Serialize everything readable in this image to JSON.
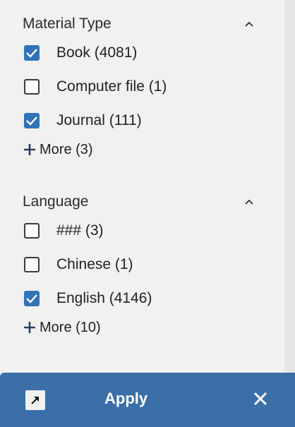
{
  "facets": [
    {
      "title": "Material Type",
      "options": [
        {
          "label": "Book (4081)",
          "checked": true
        },
        {
          "label": "Computer file (1)",
          "checked": false
        },
        {
          "label": "Journal (111)",
          "checked": true
        }
      ],
      "more_label": "More (3)"
    },
    {
      "title": "Language",
      "options": [
        {
          "label": "### (3)",
          "checked": false
        },
        {
          "label": "Chinese (1)",
          "checked": false
        },
        {
          "label": "English (4146)",
          "checked": true
        }
      ],
      "more_label": "More (10)"
    }
  ],
  "apply_bar": {
    "apply_label": "Apply",
    "expand_icon": "arrow-expand-icon",
    "close_icon": "close-icon"
  },
  "colors": {
    "accent": "#2f73b8",
    "apply_bar": "#3a6fa8",
    "panel_bg": "#f1f1f1"
  },
  "icons": {
    "checkbox_checked": "checkmark-icon",
    "collapse": "chevron-up-icon",
    "more": "plus-icon"
  }
}
